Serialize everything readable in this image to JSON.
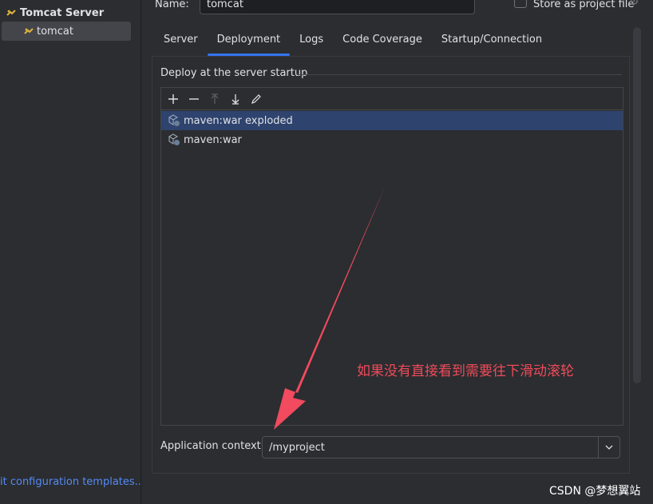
{
  "tree": {
    "root_label": "Tomcat Server",
    "child_label": "tomcat"
  },
  "footer": {
    "templates_link": "it configuration templates..."
  },
  "header": {
    "name_label": "Name:",
    "name_value": "tomcat",
    "store_label": "Store as project file"
  },
  "tabs": [
    {
      "label": "Server"
    },
    {
      "label": "Deployment"
    },
    {
      "label": "Logs"
    },
    {
      "label": "Code Coverage"
    },
    {
      "label": "Startup/Connection"
    }
  ],
  "active_tab": "Deployment",
  "deploy": {
    "section_title": "Deploy at the server startup",
    "items": [
      {
        "label": "maven:war exploded",
        "selected": true
      },
      {
        "label": "maven:war",
        "selected": false
      }
    ]
  },
  "annotation": {
    "text": "如果没有直接看到需要往下滑动滚轮",
    "color": "#f04a5a"
  },
  "context": {
    "label": "Application context:",
    "value": "/myproject"
  },
  "watermark": "CSDN @梦想翼站",
  "colors": {
    "accent": "#3574f0",
    "selection": "#2e436e",
    "link": "#548af7"
  }
}
